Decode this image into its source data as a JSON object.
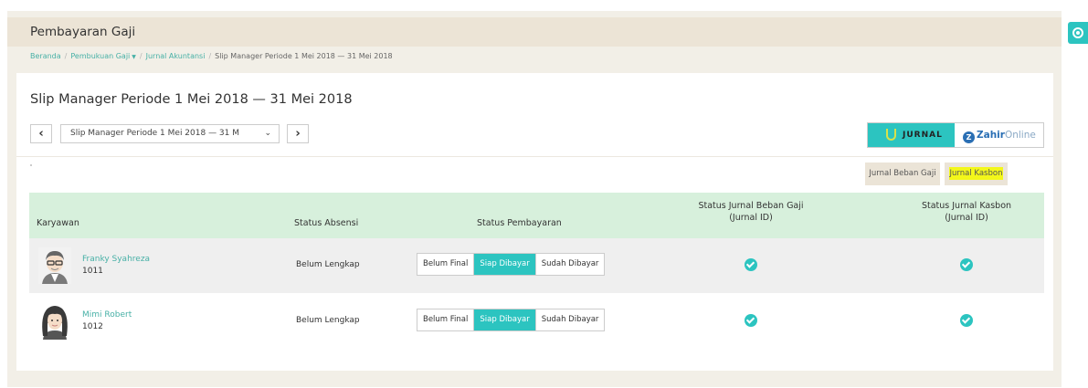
{
  "header": {
    "title": "Pembayaran Gaji"
  },
  "breadcrumb": {
    "home": "Beranda",
    "sep": "/",
    "pembukuan": "Pembukuan Gaji",
    "jurnal": "Jurnal Akuntansi",
    "current": "Slip Manager Periode 1 Mei 2018 — 31 Mei 2018"
  },
  "slip": {
    "title": "Slip Manager Periode 1 Mei 2018 — 31 Mei 2018",
    "select_value": "Slip Manager Periode 1 Mei 2018 — 31 M",
    "prev": "‹",
    "next": "›",
    "chevron": "⌄"
  },
  "brand": {
    "jurnal": "JURNAL",
    "zahir_mark": "Z",
    "zahir_bold": "Zahir",
    "zahir_light": "Online"
  },
  "actions": {
    "beban_label": "Jurnal Beban Gaji",
    "kasbon_label": "Jurnal Kasbon"
  },
  "table": {
    "headers": {
      "karyawan": "Karyawan",
      "absensi": "Status Absensi",
      "pembayaran": "Status Pembayaran",
      "beban_line1": "Status Jurnal Beban Gaji",
      "beban_line2": "(Jurnal ID)",
      "kasbon_line1": "Status Jurnal Kasbon",
      "kasbon_line2": "(Jurnal ID)"
    },
    "rows": [
      {
        "name": "Franky Syahreza",
        "id": "1011",
        "absensi": "Belum Lengkap",
        "status_options": [
          "Belum Final",
          "Siap Dibayar",
          "Sudah Dibayar"
        ],
        "selected": "Siap Dibayar"
      },
      {
        "name": "Mimi Robert",
        "id": "1012",
        "absensi": "Belum Lengkap",
        "status_options": [
          "Belum Final",
          "Siap Dibayar",
          "Sudah Dibayar"
        ],
        "selected": "Siap Dibayar"
      }
    ]
  },
  "colors": {
    "accent": "#2cc4c0",
    "link": "#47b0a6",
    "table_header": "#d7f0dc",
    "highlight": "#f3f71a"
  }
}
